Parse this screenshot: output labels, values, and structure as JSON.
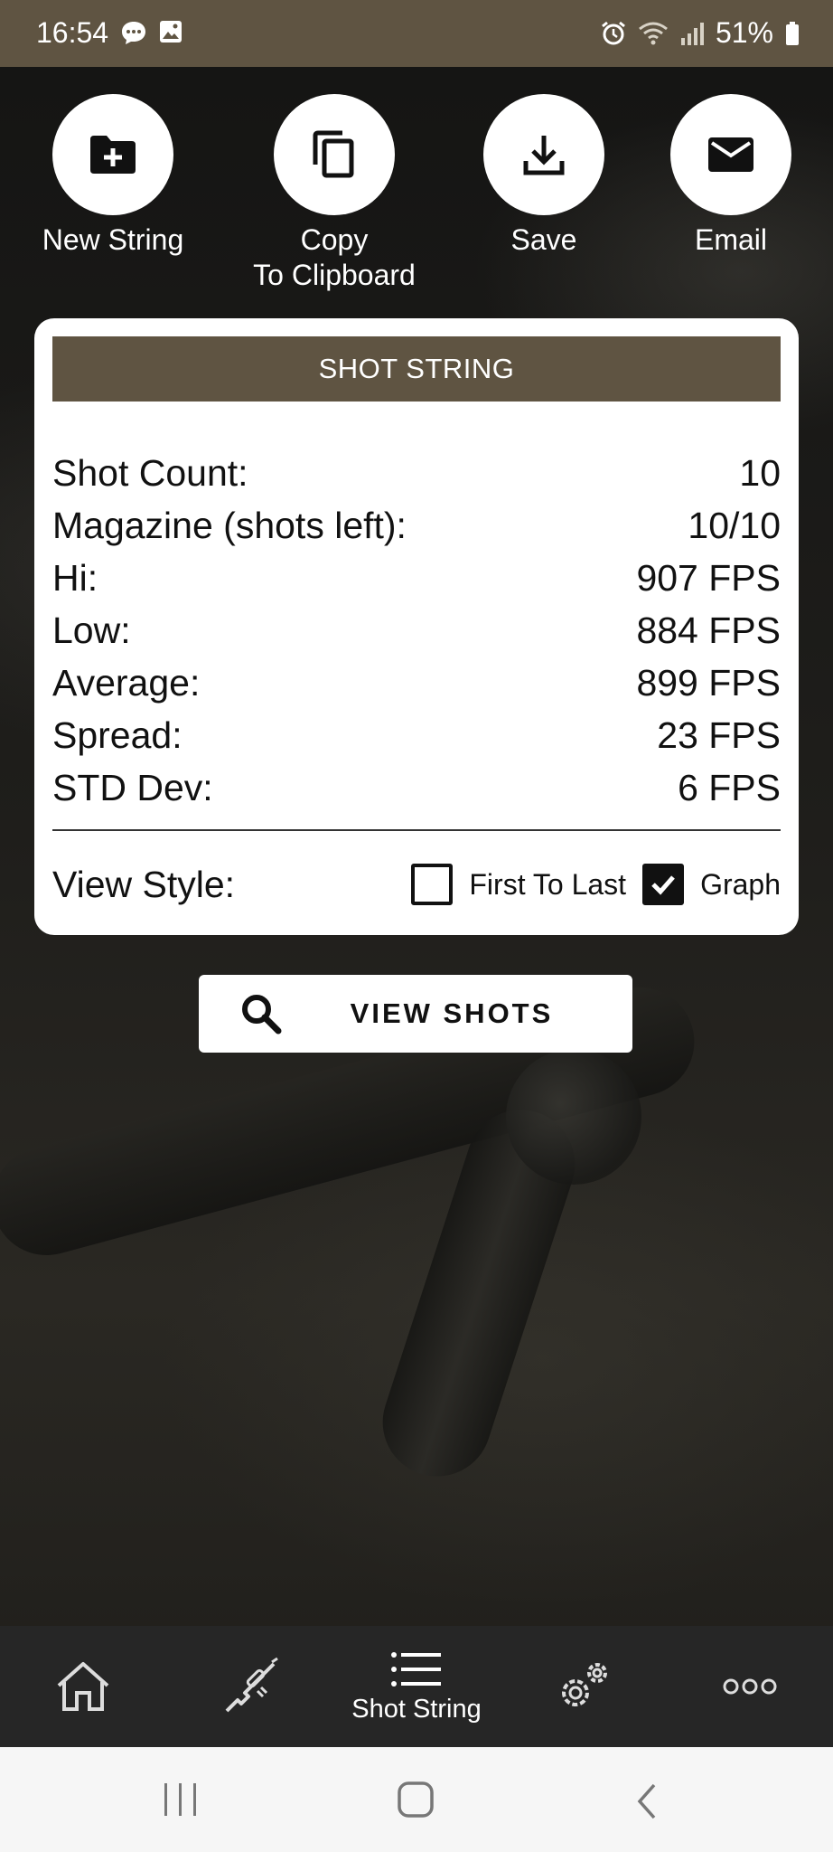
{
  "status_bar": {
    "time": "16:54",
    "battery": "51%",
    "icons": [
      "chat-bubble-icon",
      "gallery-icon",
      "alarm-icon",
      "wifi-icon",
      "signal-icon",
      "battery-icon"
    ]
  },
  "actions": [
    {
      "label": "New String",
      "icon": "folder-add-icon"
    },
    {
      "label": "Copy\nTo Clipboard",
      "icon": "copy-icon"
    },
    {
      "label": "Save",
      "icon": "download-icon"
    },
    {
      "label": "Email",
      "icon": "mail-icon"
    }
  ],
  "card": {
    "title": "SHOT STRING",
    "stats": [
      {
        "label": "Shot Count:",
        "value": "10"
      },
      {
        "label": "Magazine (shots left):",
        "value": "10/10"
      },
      {
        "label": "Hi:",
        "value": "907 FPS"
      },
      {
        "label": "Low:",
        "value": "884 FPS"
      },
      {
        "label": "Average:",
        "value": "899 FPS"
      },
      {
        "label": "Spread:",
        "value": "23 FPS"
      },
      {
        "label": "STD Dev:",
        "value": "6 FPS"
      }
    ],
    "view_style": {
      "label": "View Style:",
      "options": [
        {
          "label": "First To Last",
          "checked": false
        },
        {
          "label": "Graph",
          "checked": true
        }
      ]
    }
  },
  "view_shots_button": {
    "label": "VIEW SHOTS",
    "icon": "search-icon"
  },
  "bottom_nav": [
    {
      "label": "",
      "icon": "home-icon"
    },
    {
      "label": "",
      "icon": "rifle-icon"
    },
    {
      "label": "Shot String",
      "icon": "list-icon",
      "active": true
    },
    {
      "label": "",
      "icon": "settings-gears-icon"
    },
    {
      "label": "",
      "icon": "more-dots-icon"
    }
  ],
  "system_nav": [
    "recents-icon",
    "home-button-icon",
    "back-icon"
  ],
  "colors": {
    "brand": "#5f5442",
    "nav_bg": "#262626",
    "card_bg": "#ffffff"
  }
}
